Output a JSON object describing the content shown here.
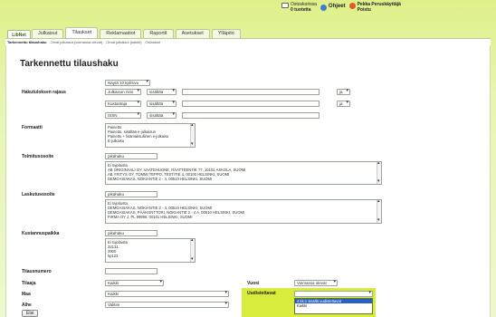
{
  "app": {
    "logo": "LibNet"
  },
  "tabs": [
    {
      "label": "Julkaisut",
      "active": false
    },
    {
      "label": "Tilaukset",
      "active": true
    },
    {
      "label": "Reklamaatiot",
      "active": false
    },
    {
      "label": "Raportit",
      "active": false
    },
    {
      "label": "Asetukset",
      "active": false
    },
    {
      "label": "Ylläpito",
      "active": false
    }
  ],
  "top_right": {
    "cart_line1": "Ostoskorissa",
    "cart_line2": "0 tuotetta",
    "help": "Ohjeet",
    "user_line1": "Pekka Peruskäyttäjä",
    "user_line2": "Poistu"
  },
  "subnav": [
    "Tarkennettu tilaushaku",
    "Omat julkaisut (voimassa olevat)",
    "Omat julkaisut (kaikki)",
    "Ostoskori"
  ],
  "page_title": "Tarkennettu tilaushaku",
  "search": {
    "per_page": "Näytä 10 kpl/sivu",
    "label_limit": "Hakutuloksen rajaus",
    "rows": [
      {
        "field": "Julkaisun nimi",
        "op": "sisältää",
        "value": "",
        "join": "ja"
      },
      {
        "field": "Kustantaja",
        "op": "sisältää",
        "value": "",
        "join": "ja"
      },
      {
        "field": "ISSN",
        "op": "sisältää",
        "value": "",
        "join": ""
      }
    ]
  },
  "format": {
    "label": "Formaatti",
    "options": [
      "Painettu",
      "Painettu, sisältää e-julkaisun",
      "Painettu + lisämaksullinen e-julkaisu",
      "E-julkaisu"
    ]
  },
  "delivery": {
    "label": "Toimitusosoite",
    "quick": "pikahaku",
    "options": [
      "Ei rajoitusta",
      "AB ORIGINAALI OY, VAATEHUONE, RAATTEENTIE 77, 10101 ASKOLA, SUOMI",
      "AB YRITYS OY, TOMMI TEPPO, TESTITIE 4, 00100 HELSINKI, SUOMI",
      "DEMOASIAKAS, NOKIANTIE 2 - 4, 00510 HELSINKI, SUOMI"
    ]
  },
  "billing": {
    "label": "Laskutusosoite",
    "quick": "pikahaku",
    "options": [
      "Ei rajoitusta",
      "DEMOASIAKAS, NOKIANTIE 2 - 4, 00510 HELSINKI, SUOMI",
      "DEMOASIAKAS, PÄÄKONTTORI, NOKIANTIE 2 - 4 A, 00510 HELSINKI, SUOMI",
      "FIRMA OY J, PL 99999, 00101 HELSINKI, SUOMI"
    ]
  },
  "cost_center": {
    "label": "Kustannuspaikka",
    "quick": "pikahaku",
    "options": [
      "Ei rajoitusta",
      "32131",
      "3900",
      "kp123"
    ]
  },
  "order_number": {
    "label": "Tilausnumero",
    "value": ""
  },
  "orderer": {
    "label": "Tilaaja",
    "value": "Kaikki"
  },
  "country": {
    "label": "Maa",
    "value": "Kaikki"
  },
  "subject": {
    "label": "Aihe",
    "value": "Valitse"
  },
  "year": {
    "label": "Vuosi",
    "value": "Voimassa olevat"
  },
  "renewable": {
    "label": "Uudistettavat",
    "value": "",
    "options": [
      "4 kk:n sisällä uudistettavat",
      "Kaikki"
    ]
  },
  "search_button": "Etsi"
}
